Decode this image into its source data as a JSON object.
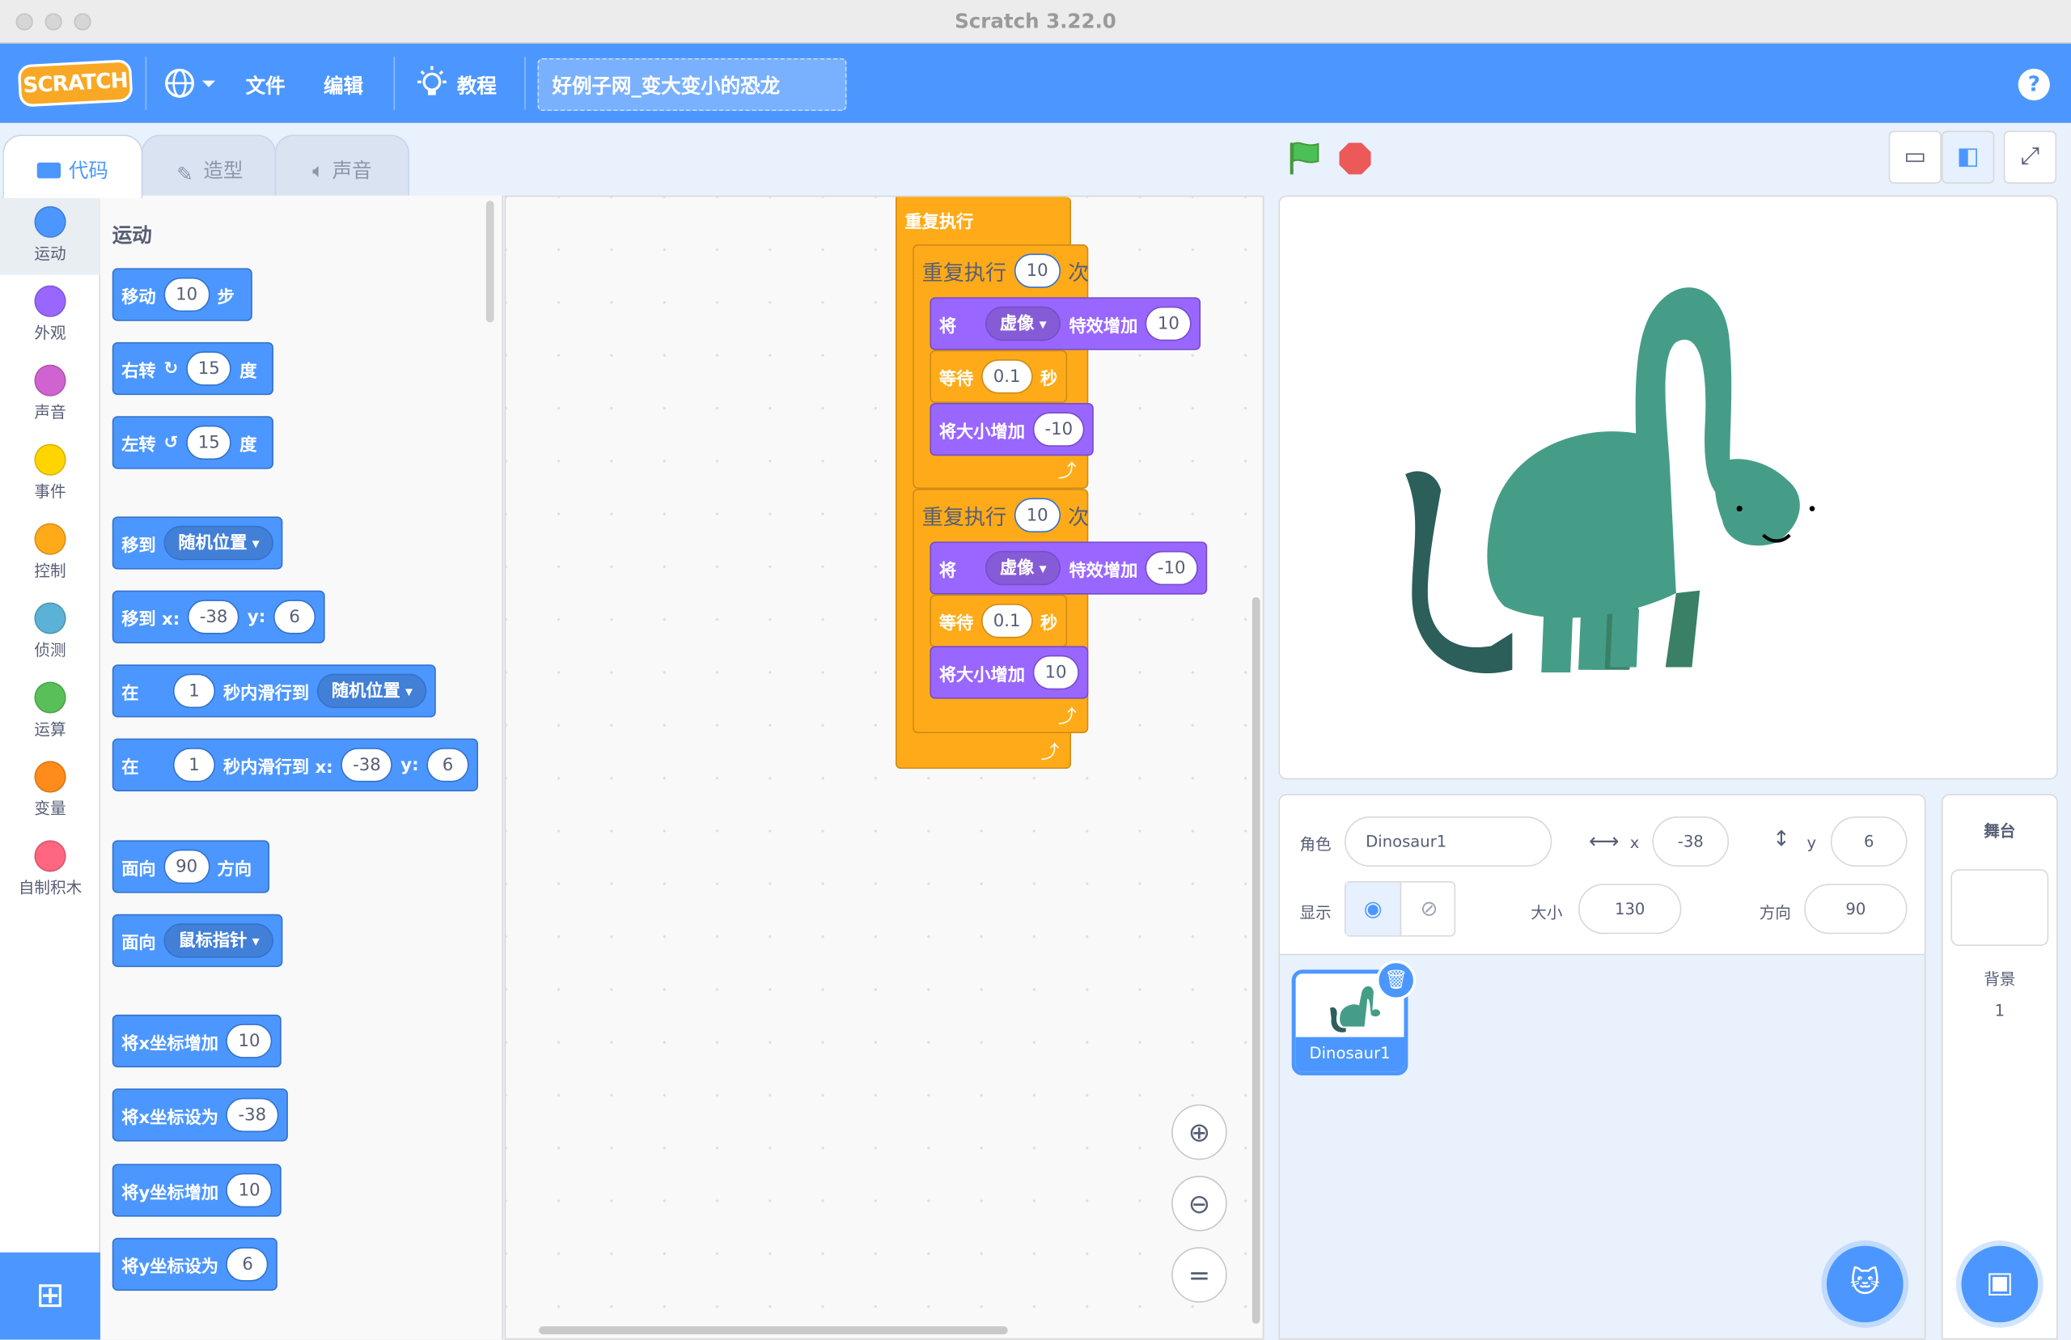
{
  "window": {
    "title": "Scratch 3.22.0"
  },
  "menubar": {
    "logo_text": "SCRATCH",
    "file": "文件",
    "edit": "编辑",
    "tutorials": "教程",
    "project_title": "好例子网_变大变小的恐龙",
    "help": "?"
  },
  "tabs": {
    "code": "代码",
    "costumes": "造型",
    "sounds": "声音"
  },
  "categories": [
    {
      "label": "运动",
      "color": "#4c97ff"
    },
    {
      "label": "外观",
      "color": "#9966ff"
    },
    {
      "label": "声音",
      "color": "#cf63cf"
    },
    {
      "label": "事件",
      "color": "#ffd500"
    },
    {
      "label": "控制",
      "color": "#ffab19"
    },
    {
      "label": "侦测",
      "color": "#5cb1d6"
    },
    {
      "label": "运算",
      "color": "#59c059"
    },
    {
      "label": "变量",
      "color": "#ff8c1a"
    },
    {
      "label": "自制积木",
      "color": "#ff6680"
    }
  ],
  "palette": {
    "heading": "运动",
    "move": {
      "a": "移动",
      "v": "10",
      "b": "步"
    },
    "turn_right": {
      "a": "右转",
      "v": "15",
      "b": "度"
    },
    "turn_left": {
      "a": "左转",
      "v": "15",
      "b": "度"
    },
    "goto": {
      "a": "移到",
      "d": "随机位置"
    },
    "goto_xy": {
      "a": "移到 x:",
      "x": "-38",
      "b": "y:",
      "y": "6"
    },
    "glide": {
      "a": "在",
      "v": "1",
      "b": "秒内滑行到",
      "d": "随机位置"
    },
    "glide_xy": {
      "a": "在",
      "v": "1",
      "b": "秒内滑行到 x:",
      "x": "-38",
      "c": "y:",
      "y": "6"
    },
    "point_dir": {
      "a": "面向",
      "v": "90",
      "b": "方向"
    },
    "point_towards": {
      "a": "面向",
      "d": "鼠标指针"
    },
    "change_x": {
      "a": "将x坐标增加",
      "v": "10"
    },
    "set_x": {
      "a": "将x坐标设为",
      "v": "-38"
    },
    "change_y": {
      "a": "将y坐标增加",
      "v": "10"
    },
    "set_y": {
      "a": "将y坐标设为",
      "v": "6"
    }
  },
  "script": {
    "forever": "重复执行",
    "repeat1": {
      "a": "重复执行",
      "v": "10",
      "b": "次"
    },
    "effect1": {
      "a": "将",
      "d": "虚像",
      "b": "特效增加",
      "v": "10"
    },
    "wait1": {
      "a": "等待",
      "v": "0.1",
      "b": "秒"
    },
    "size1": {
      "a": "将大小增加",
      "v": "-10"
    },
    "repeat2": {
      "a": "重复执行",
      "v": "10",
      "b": "次"
    },
    "effect2": {
      "a": "将",
      "d": "虚像",
      "b": "特效增加",
      "v": "-10"
    },
    "wait2": {
      "a": "等待",
      "v": "0.1",
      "b": "秒"
    },
    "size2": {
      "a": "将大小增加",
      "v": "10"
    }
  },
  "sprite_info": {
    "sprite_label": "角色",
    "sprite_name": "Dinosaur1",
    "x_label": "x",
    "x": "-38",
    "y_label": "y",
    "y": "6",
    "show_label": "显示",
    "size_label": "大小",
    "size": "130",
    "direction_label": "方向",
    "direction": "90"
  },
  "sprite_list": [
    {
      "name": "Dinosaur1"
    }
  ],
  "stage_panel": {
    "title": "舞台",
    "backdrops_label": "背景",
    "backdrops_count": "1"
  },
  "colors": {
    "accent": "#4c97ff",
    "motion": "#4c97ff",
    "looks": "#9966ff",
    "control": "#ffab19",
    "dino": "#459d88"
  }
}
